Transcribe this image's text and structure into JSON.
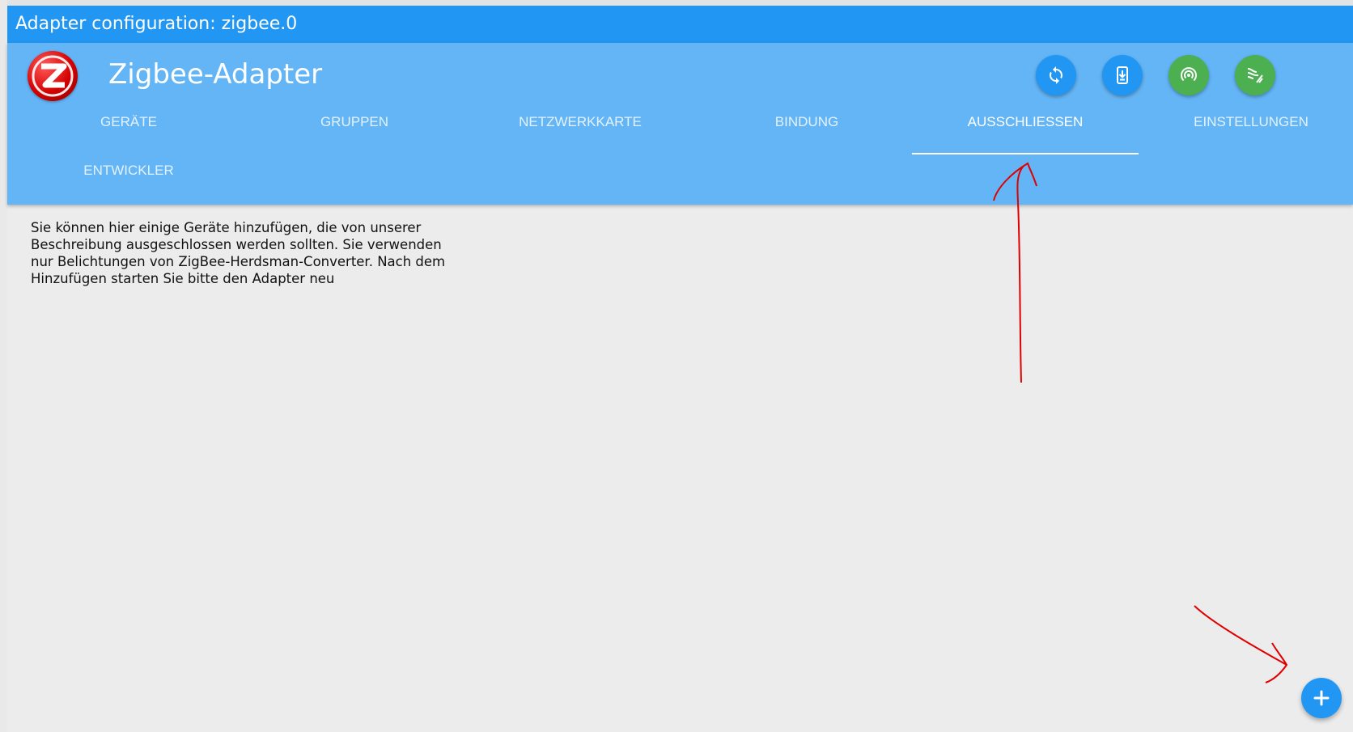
{
  "window": {
    "title": "Adapter configuration: zigbee.0"
  },
  "header": {
    "logo_icon": "zigbee-logo-icon",
    "title": "Zigbee-Adapter",
    "actions": [
      {
        "icon": "refresh-icon",
        "color": "#2196f3"
      },
      {
        "icon": "device-download-icon",
        "color": "#2196f3"
      },
      {
        "icon": "wifi-tethering-icon",
        "color": "#4caf50"
      },
      {
        "icon": "signal-leak-icon",
        "color": "#4caf50"
      }
    ]
  },
  "tabs": [
    {
      "label": "GERÄTE"
    },
    {
      "label": "GRUPPEN"
    },
    {
      "label": "NETZWERKKARTE"
    },
    {
      "label": "BINDUNG"
    },
    {
      "label": "AUSSCHLIESSEN",
      "active": true
    },
    {
      "label": "EINSTELLUNGEN"
    },
    {
      "label": "ENTWICKLER"
    }
  ],
  "main": {
    "description": "Sie können hier einige Geräte hinzufügen, die von unserer Beschreibung ausgeschlossen werden sollten. Sie verwenden nur Belichtungen von ZigBee-Herdsman-Converter. Nach dem Hinzufügen starten Sie bitte den Adapter neu"
  },
  "fab": {
    "icon": "plus-icon"
  },
  "colors": {
    "titlebar": "#2196f3",
    "header": "#64b5f6",
    "accent_blue": "#2196f3",
    "accent_green": "#4caf50",
    "annotation": "#e00000"
  }
}
